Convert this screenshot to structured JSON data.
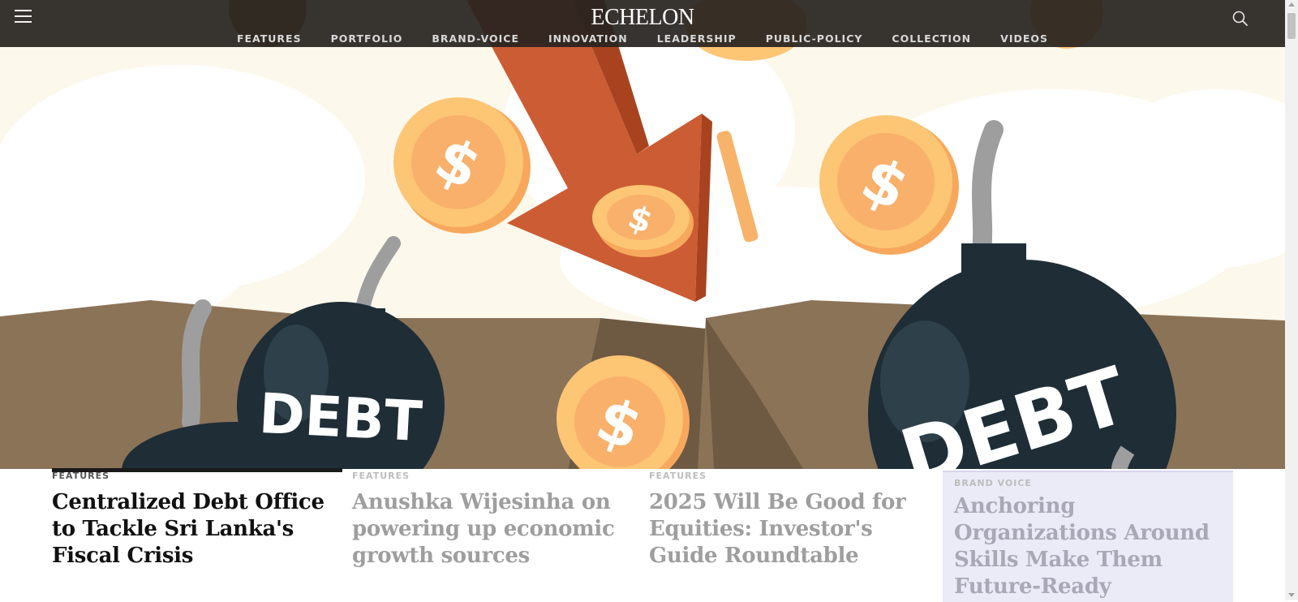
{
  "header": {
    "logo": "ECHELON",
    "menu_icon": "hamburger-menu-icon",
    "search_icon": "search-icon",
    "nav": [
      "FEATURES",
      "PORTFOLIO",
      "BRAND-VOICE",
      "INNOVATION",
      "LEADERSHIP",
      "PUBLIC-POLICY",
      "COLLECTION",
      "VIDEOS"
    ]
  },
  "hero": {
    "bomb_left_label": "DEBT",
    "bomb_right_label": "DEBT",
    "coin_symbol": "$"
  },
  "stories": [
    {
      "category": "FEATURES",
      "title": "Centralized Debt Office to Tackle Sri Lanka's Fiscal Crisis"
    },
    {
      "category": "FEATURES",
      "title": "Anushka Wijesinha on powering up economic growth sources"
    },
    {
      "category": "FEATURES",
      "title": "2025 Will Be Good for Equities: Investor's Guide Roundtable"
    },
    {
      "category": "BRAND VOICE",
      "title": "Anchoring Organizations Around Skills Make Them Future-Ready"
    }
  ],
  "colors": {
    "header_bg": "#282420",
    "hero_bg": "#fdf8ec",
    "arrow": "#cc5c34",
    "coin": "#fbbf6a",
    "bomb": "#1e2d36",
    "ground": "#8b7358",
    "brand_voice_bg": "#ebeaf7"
  }
}
